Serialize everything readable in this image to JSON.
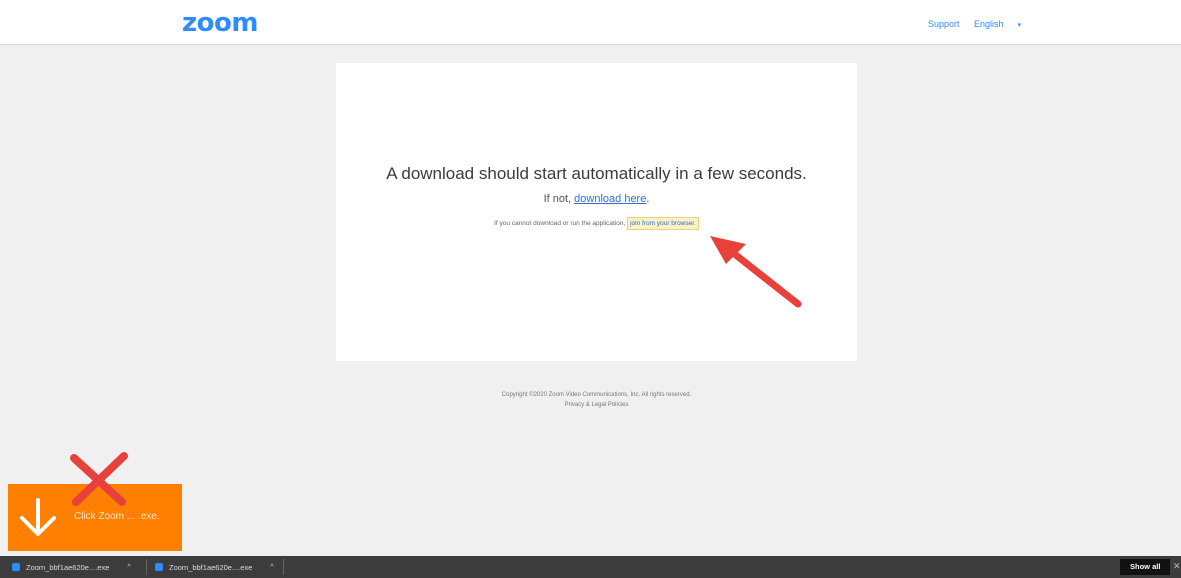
{
  "header": {
    "logo": "zoom",
    "support_label": "Support",
    "language_label": "English",
    "language_caret": "▾"
  },
  "card": {
    "headline": "A download should start automatically in a few seconds.",
    "if_not_prefix": "If not, ",
    "download_link": "download here",
    "if_not_suffix": ".",
    "cannot_prefix": "If you cannot download or run the application, ",
    "join_link": "join from your browser."
  },
  "footer": {
    "copyright": "Copyright ©2020 Zoom Video Communications, Inc. All rights reserved.",
    "privacy": "Privacy & Legal Policies"
  },
  "overlay": {
    "label": "Click Zoom ... .exe."
  },
  "downloads": {
    "items": [
      {
        "filename": "Zoom_bbf1ae620e....exe",
        "caret": "^"
      },
      {
        "filename": "Zoom_bbf1ae620e....exe",
        "caret": "^"
      }
    ],
    "show_all_label": "Show all",
    "close_label": "✕"
  },
  "colors": {
    "brand": "#2d8cff",
    "overlay": "#ff7f00",
    "annotation": "#e8413b"
  }
}
